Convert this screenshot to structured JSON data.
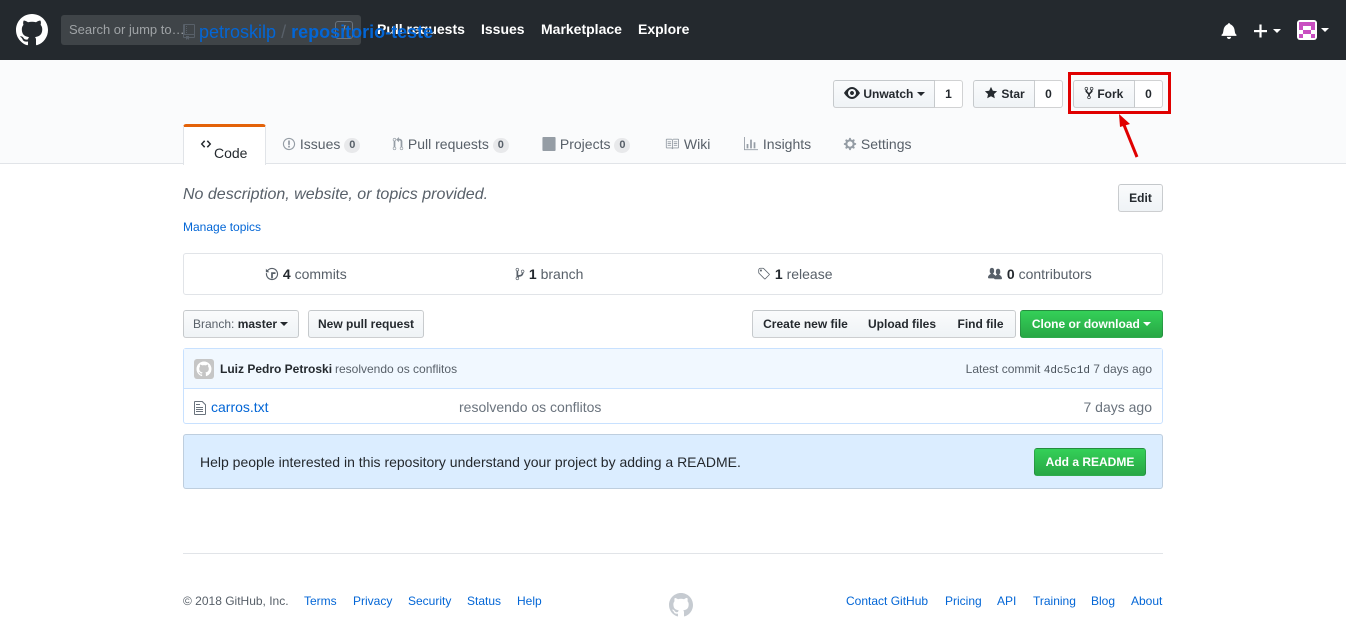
{
  "header": {
    "search_placeholder": "Search or jump to…",
    "search_shortcut": "/",
    "nav": [
      "Pull requests",
      "Issues",
      "Marketplace",
      "Explore"
    ]
  },
  "repo": {
    "owner": "petroskilp",
    "separator": "/",
    "name": "repositorio-teste",
    "watch": {
      "label": "Unwatch",
      "count": "1"
    },
    "star": {
      "label": "Star",
      "count": "0"
    },
    "fork": {
      "label": "Fork",
      "count": "0"
    }
  },
  "tabs": [
    {
      "label": "Code"
    },
    {
      "label": "Issues",
      "count": "0"
    },
    {
      "label": "Pull requests",
      "count": "0"
    },
    {
      "label": "Projects",
      "count": "0"
    },
    {
      "label": "Wiki"
    },
    {
      "label": "Insights"
    },
    {
      "label": "Settings"
    }
  ],
  "description": "No description, website, or topics provided.",
  "manage_topics": "Manage topics",
  "edit_label": "Edit",
  "summary": {
    "commits": {
      "count": "4",
      "label": "commits"
    },
    "branch": {
      "count": "1",
      "label": "branch"
    },
    "release": {
      "count": "1",
      "label": "release"
    },
    "contributors": {
      "count": "0",
      "label": "contributors"
    }
  },
  "toolbar": {
    "branch_prefix": "Branch:",
    "branch_name": "master",
    "new_pr": "New pull request",
    "create_file": "Create new file",
    "upload_files": "Upload files",
    "find_file": "Find file",
    "clone": "Clone or download"
  },
  "commit": {
    "author": "Luiz Pedro Petroski",
    "message": "resolvendo os conflitos",
    "latest_label": "Latest commit",
    "sha": "4dc5c1d",
    "age": "7 days ago"
  },
  "files": [
    {
      "name": "carros.txt",
      "message": "resolvendo os conflitos",
      "age": "7 days ago"
    }
  ],
  "readme": {
    "text": "Help people interested in this repository understand your project by adding a README.",
    "button": "Add a README"
  },
  "footer": {
    "copyright": "© 2018 GitHub, Inc.",
    "left_links": [
      "Terms",
      "Privacy",
      "Security",
      "Status",
      "Help"
    ],
    "right_links": [
      "Contact GitHub",
      "Pricing",
      "API",
      "Training",
      "Blog",
      "About"
    ]
  },
  "colors": {
    "header_bg": "#24292e",
    "link": "#0366d6",
    "highlight": "#e00000",
    "green": "#28a745",
    "active_tab": "#e36209"
  }
}
